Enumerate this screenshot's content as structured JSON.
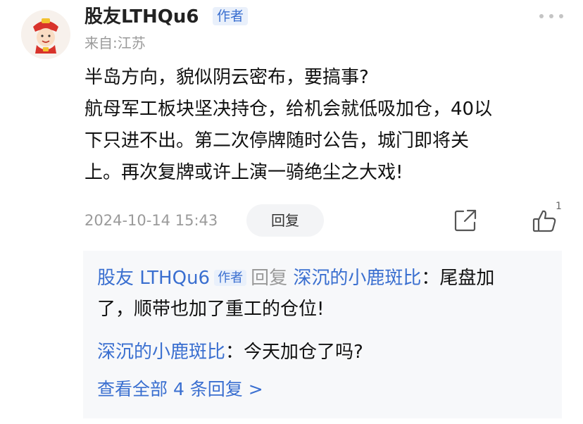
{
  "post": {
    "username": "股友LTHQu6",
    "author_badge": "作者",
    "origin": "来自:江苏",
    "content_lines": [
      "半岛方向，貌似阴云密布，要搞事?",
      "航母军工板块坚决持仓，给机会就低吸加仓，40以",
      "下只进不出。第二次停牌随时公告，城门即将关",
      "上。再次复牌或许上演一骑绝尘之大戏!"
    ],
    "timestamp": "2024-10-14 15:43",
    "reply_label": "回复",
    "like_count": "1"
  },
  "replies": {
    "first": {
      "from": "股友 LTHQu6",
      "badge": "作者",
      "reply_word": "回复",
      "to": "深沉的小鹿斑比",
      "colon": "：",
      "text_line1": "尾盘加",
      "text_line2": "了，顺带也加了重工的仓位!"
    },
    "second": {
      "from": "深沉的小鹿斑比",
      "colon": "：",
      "text": "今天加仓了吗?"
    },
    "view_all": "查看全部 4 条回复 >"
  },
  "icons": {
    "more": "more-dots-icon",
    "share": "share-icon",
    "like": "thumbs-up-icon"
  },
  "colors": {
    "link": "#3a6fd0",
    "muted": "#9a9a9a",
    "reply_bg": "#f7f8fa"
  }
}
